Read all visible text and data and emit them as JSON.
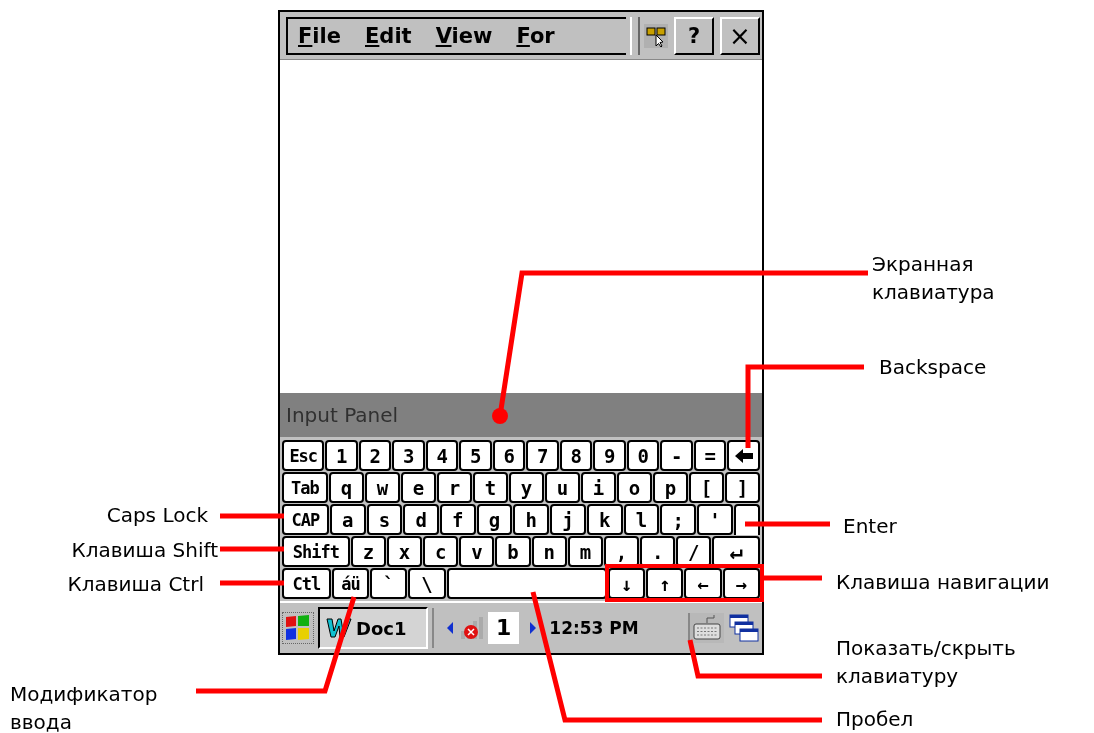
{
  "menu_bar": {
    "items": [
      "File",
      "Edit",
      "View",
      "For"
    ],
    "help_button": "?",
    "close_button": "×"
  },
  "input_panel": {
    "title": "Input Panel"
  },
  "keyboard": {
    "rows": [
      {
        "keys": [
          {
            "kind": "mod",
            "label": "Esc"
          },
          {
            "kind": "char",
            "label": "1"
          },
          {
            "kind": "char",
            "label": "2"
          },
          {
            "kind": "char",
            "label": "3"
          },
          {
            "kind": "char",
            "label": "4"
          },
          {
            "kind": "char",
            "label": "5"
          },
          {
            "kind": "char",
            "label": "6"
          },
          {
            "kind": "char",
            "label": "7"
          },
          {
            "kind": "char",
            "label": "8"
          },
          {
            "kind": "char",
            "label": "9"
          },
          {
            "kind": "char",
            "label": "0"
          },
          {
            "kind": "char",
            "label": "-"
          },
          {
            "kind": "char",
            "label": "="
          },
          {
            "kind": "backspace"
          }
        ]
      },
      {
        "keys": [
          {
            "kind": "mod",
            "label": "Tab"
          },
          {
            "kind": "char",
            "label": "q"
          },
          {
            "kind": "char",
            "label": "w"
          },
          {
            "kind": "char",
            "label": "e"
          },
          {
            "kind": "char",
            "label": "r"
          },
          {
            "kind": "char",
            "label": "t"
          },
          {
            "kind": "char",
            "label": "y"
          },
          {
            "kind": "char",
            "label": "u"
          },
          {
            "kind": "char",
            "label": "i"
          },
          {
            "kind": "char",
            "label": "o"
          },
          {
            "kind": "char",
            "label": "p"
          },
          {
            "kind": "char",
            "label": "["
          },
          {
            "kind": "char",
            "label": "]"
          }
        ]
      },
      {
        "keys": [
          {
            "kind": "mod",
            "label": "CAP"
          },
          {
            "kind": "char",
            "label": "a"
          },
          {
            "kind": "char",
            "label": "s"
          },
          {
            "kind": "char",
            "label": "d"
          },
          {
            "kind": "char",
            "label": "f"
          },
          {
            "kind": "char",
            "label": "g"
          },
          {
            "kind": "char",
            "label": "h"
          },
          {
            "kind": "char",
            "label": "j"
          },
          {
            "kind": "char",
            "label": "k"
          },
          {
            "kind": "char",
            "label": "l"
          },
          {
            "kind": "char",
            "label": ";"
          },
          {
            "kind": "char",
            "label": "'"
          },
          {
            "kind": "enter-top"
          }
        ]
      },
      {
        "keys": [
          {
            "kind": "mod",
            "label": "Shift"
          },
          {
            "kind": "char",
            "label": "z"
          },
          {
            "kind": "char",
            "label": "x"
          },
          {
            "kind": "char",
            "label": "c"
          },
          {
            "kind": "char",
            "label": "v"
          },
          {
            "kind": "char",
            "label": "b"
          },
          {
            "kind": "char",
            "label": "n"
          },
          {
            "kind": "char",
            "label": "m"
          },
          {
            "kind": "char",
            "label": ","
          },
          {
            "kind": "char",
            "label": "."
          },
          {
            "kind": "char",
            "label": "/"
          },
          {
            "kind": "enter",
            "label": "↵"
          }
        ]
      },
      {
        "keys": [
          {
            "kind": "mod",
            "label": "Ctl"
          },
          {
            "kind": "mod",
            "label": "áü"
          },
          {
            "kind": "char",
            "label": "`"
          },
          {
            "kind": "char",
            "label": "\\"
          },
          {
            "kind": "space"
          },
          {
            "kind": "char",
            "label": "↓"
          },
          {
            "kind": "char",
            "label": "↑"
          },
          {
            "kind": "char",
            "label": "←"
          },
          {
            "kind": "char",
            "label": "→"
          }
        ]
      }
    ]
  },
  "taskbar": {
    "task_button": "Doc1",
    "input_value": "1",
    "clock": "12:53 PM"
  },
  "callouts": [
    {
      "text": "Экранная\nклавиатура"
    },
    {
      "text": "Backspace"
    },
    {
      "text": "Caps Lock"
    },
    {
      "text": "Клавиша Shift"
    },
    {
      "text": "Клавиша Ctrl"
    },
    {
      "text": "Enter"
    },
    {
      "text": "Клавиша навигации"
    },
    {
      "text": "Показать/скрыть\nклавиатуру"
    },
    {
      "text": "Пробел"
    },
    {
      "text": "Модификатор\nввода"
    }
  ]
}
